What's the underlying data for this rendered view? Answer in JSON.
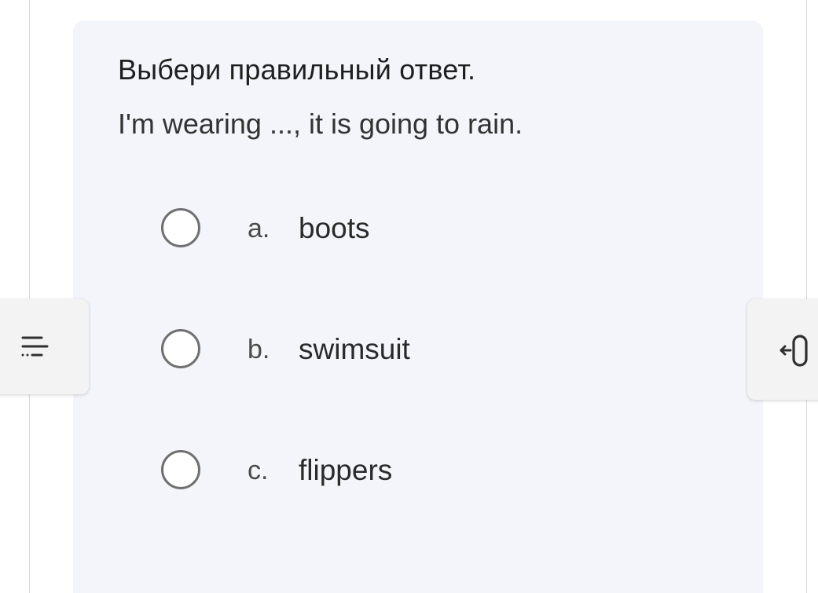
{
  "question": {
    "prompt": "Выбери правильный ответ.",
    "sentence": "I'm wearing ..., it is going to rain.",
    "options": [
      {
        "letter": "a.",
        "text": "boots"
      },
      {
        "letter": "b.",
        "text": "swimsuit"
      },
      {
        "letter": "c.",
        "text": "flippers"
      }
    ]
  },
  "side_controls": {
    "left_icon": "menu-lines-icon",
    "right_icon": "exit-arrow-icon"
  },
  "colors": {
    "card_background": "#f4f5fa",
    "radio_border": "#707070",
    "side_button_background": "#f3f3f3"
  }
}
